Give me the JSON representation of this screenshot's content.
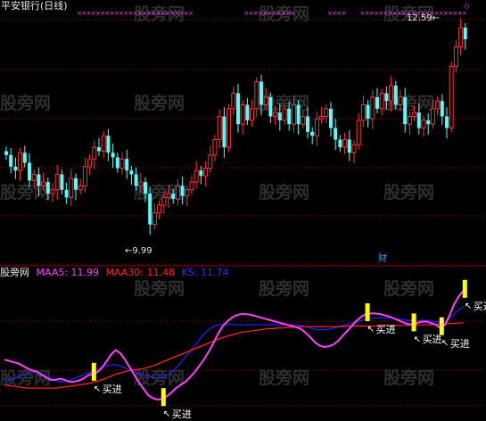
{
  "title": "平安银行(日线)",
  "watermark": "股旁网",
  "high_label": "12.59",
  "low_label": "9.99",
  "finance_marker": "财",
  "legend": {
    "prefix": "股旁网",
    "maa5": "MAA5: 11.99",
    "maa30": "MAA30: 11.48",
    "ks": "KS: 11.74"
  },
  "buy_label": "买进",
  "colors": {
    "up": "#ff3232",
    "down": "#54fcfc",
    "maa5": "#ff40ff",
    "maa30": "#ff2020",
    "ks": "#2020ff",
    "signal": "#ffff00",
    "grid": "#7a0000"
  },
  "chart_data": [
    {
      "type": "candlestick",
      "title": "平安银行(日线)",
      "x_index": "bar number 0–99 (no dates printed)",
      "ylim": [
        9.7,
        12.75
      ],
      "annotations": [
        {
          "text": "12.59",
          "at_bar": 95,
          "value": 12.59
        },
        {
          "text": "9.99",
          "at_bar": 31,
          "value": 9.99
        },
        {
          "text": "财",
          "at_bar": 86
        }
      ],
      "close": [
        10.95,
        10.8,
        10.75,
        10.98,
        10.85,
        10.62,
        10.7,
        10.55,
        10.6,
        10.45,
        10.5,
        10.7,
        10.5,
        10.4,
        10.65,
        10.5,
        10.55,
        10.8,
        10.9,
        11.05,
        11.0,
        11.2,
        10.98,
        10.92,
        10.78,
        10.9,
        10.75,
        10.7,
        10.55,
        10.6,
        10.45,
        10.05,
        10.2,
        10.3,
        10.4,
        10.45,
        10.38,
        10.55,
        10.42,
        10.5,
        10.6,
        10.75,
        10.68,
        10.78,
        10.95,
        11.15,
        11.45,
        11.05,
        11.55,
        11.75,
        11.35,
        11.6,
        11.4,
        11.55,
        11.9,
        11.6,
        11.7,
        11.45,
        11.5,
        11.4,
        11.55,
        11.35,
        11.6,
        11.35,
        11.45,
        11.25,
        11.2,
        11.42,
        11.45,
        11.55,
        11.3,
        11.15,
        11.05,
        11.15,
        10.98,
        11.08,
        11.4,
        11.6,
        11.42,
        11.7,
        11.55,
        11.75,
        11.65,
        11.85,
        11.6,
        11.7,
        11.35,
        11.45,
        11.5,
        11.3,
        11.4,
        11.35,
        11.55,
        11.65,
        11.45,
        11.3,
        12.1,
        12.35,
        12.6,
        12.45
      ],
      "signals_buy_bars": [
        19,
        34,
        78,
        88,
        94,
        99
      ]
    },
    {
      "type": "line",
      "series": [
        {
          "name": "MAA5",
          "color": "#ff40ff",
          "last": 11.99,
          "values": [
            10.9,
            10.88,
            10.86,
            10.84,
            10.8,
            10.76,
            10.73,
            10.71,
            10.66,
            10.62,
            10.58,
            10.58,
            10.6,
            10.58,
            10.55,
            10.55,
            10.57,
            10.6,
            10.65,
            10.68,
            10.7,
            10.77,
            10.87,
            10.98,
            11.05,
            11.0,
            10.9,
            10.78,
            10.66,
            10.54,
            10.44,
            10.34,
            10.29,
            10.27,
            10.28,
            10.32,
            10.38,
            10.45,
            10.5,
            10.55,
            10.62,
            10.7,
            10.8,
            10.9,
            11.02,
            11.15,
            11.3,
            11.42,
            11.5,
            11.56,
            11.6,
            11.62,
            11.62,
            11.61,
            11.59,
            11.57,
            11.55,
            11.53,
            11.51,
            11.49,
            11.47,
            11.45,
            11.43,
            11.41,
            11.38,
            11.32,
            11.25,
            11.17,
            11.12,
            11.1,
            11.11,
            11.14,
            11.2,
            11.28,
            11.36,
            11.44,
            11.52,
            11.58,
            11.62,
            11.63,
            11.63,
            11.62,
            11.6,
            11.58,
            11.55,
            11.52,
            11.49,
            11.46,
            11.46,
            11.48,
            11.5,
            11.5,
            11.48,
            11.45,
            11.4,
            11.45,
            11.6,
            11.78,
            11.9,
            11.99
          ]
        },
        {
          "name": "MAA30",
          "color": "#ff2020",
          "last": 11.48,
          "values": [
            10.5,
            10.49,
            10.48,
            10.47,
            10.46,
            10.45,
            10.45,
            10.45,
            10.45,
            10.45,
            10.45,
            10.45,
            10.46,
            10.47,
            10.48,
            10.49,
            10.5,
            10.51,
            10.52,
            10.54,
            10.56,
            10.58,
            10.61,
            10.64,
            10.67,
            10.69,
            10.71,
            10.73,
            10.74,
            10.75,
            10.76,
            10.78,
            10.8,
            10.83,
            10.86,
            10.89,
            10.92,
            10.95,
            10.98,
            11.01,
            11.04,
            11.07,
            11.1,
            11.13,
            11.16,
            11.19,
            11.22,
            11.25,
            11.27,
            11.29,
            11.31,
            11.33,
            11.34,
            11.35,
            11.36,
            11.37,
            11.38,
            11.39,
            11.39,
            11.4,
            11.4,
            11.41,
            11.41,
            11.42,
            11.42,
            11.42,
            11.42,
            11.42,
            11.42,
            11.42,
            11.42,
            11.42,
            11.42,
            11.42,
            11.43,
            11.43,
            11.43,
            11.43,
            11.43,
            11.43,
            11.43,
            11.43,
            11.44,
            11.44,
            11.44,
            11.44,
            11.44,
            11.44,
            11.45,
            11.45,
            11.45,
            11.45,
            11.45,
            11.46,
            11.46,
            11.46,
            11.47,
            11.47,
            11.48,
            11.48
          ]
        },
        {
          "name": "KS",
          "color": "#2020ff",
          "last": 11.74,
          "values": [
            10.55,
            10.58,
            10.6,
            10.63,
            10.66,
            10.69,
            10.7,
            10.7,
            10.68,
            10.64,
            10.6,
            10.57,
            10.55,
            10.55,
            10.57,
            10.6,
            10.63,
            10.66,
            10.69,
            10.72,
            10.75,
            10.78,
            10.8,
            10.82,
            10.82,
            10.8,
            10.77,
            10.74,
            10.71,
            10.68,
            10.66,
            10.64,
            10.62,
            10.61,
            10.62,
            10.65,
            10.7,
            10.77,
            10.85,
            10.94,
            11.03,
            11.12,
            11.21,
            11.3,
            11.37,
            11.42,
            11.45,
            11.46,
            11.46,
            11.46,
            11.45,
            11.45,
            11.45,
            11.45,
            11.45,
            11.45,
            11.45,
            11.45,
            11.45,
            11.45,
            11.45,
            11.45,
            11.45,
            11.45,
            11.44,
            11.42,
            11.4,
            11.38,
            11.37,
            11.37,
            11.38,
            11.4,
            11.42,
            11.44,
            11.46,
            11.48,
            11.5,
            11.52,
            11.54,
            11.55,
            11.56,
            11.56,
            11.56,
            11.56,
            11.55,
            11.54,
            11.53,
            11.52,
            11.52,
            11.52,
            11.52,
            11.52,
            11.51,
            11.5,
            11.49,
            11.5,
            11.55,
            11.62,
            11.69,
            11.74
          ]
        }
      ]
    }
  ]
}
